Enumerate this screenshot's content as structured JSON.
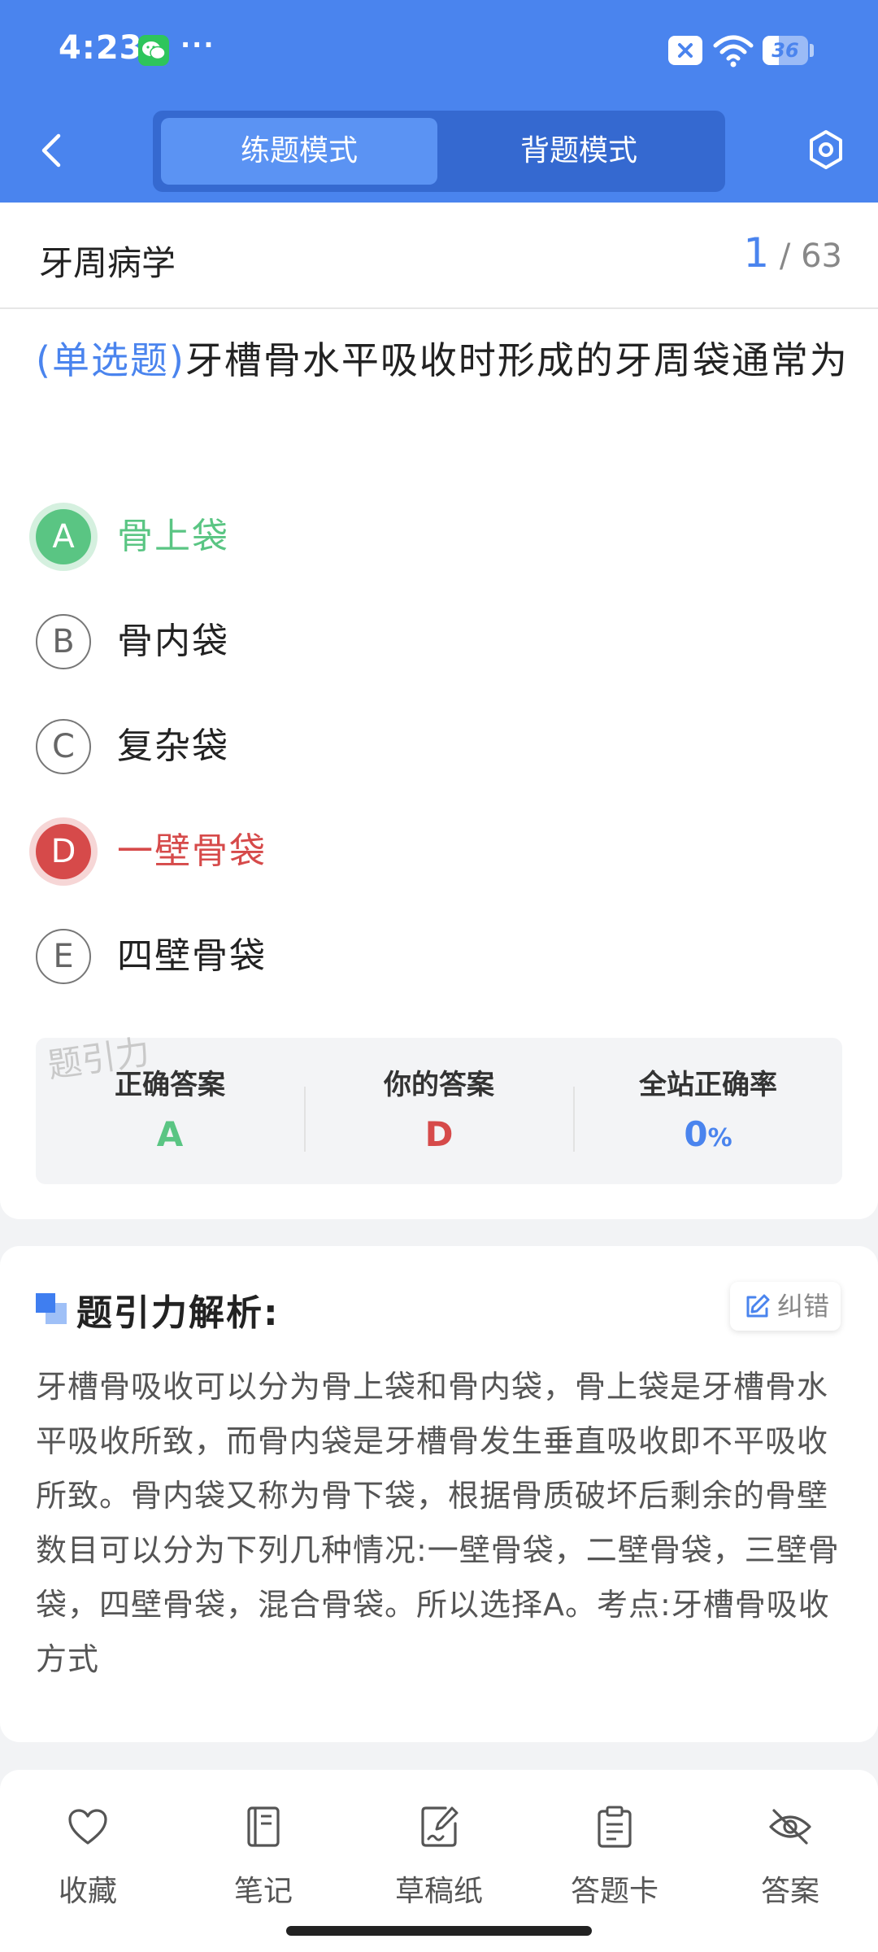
{
  "status_bar": {
    "time": "4:23",
    "battery": "36",
    "battery_level": 0.36
  },
  "header": {
    "tabs": [
      {
        "label": "练题模式",
        "active": true
      },
      {
        "label": "背题模式",
        "active": false
      }
    ]
  },
  "question_header": {
    "subject": "牙周病学",
    "current": "1",
    "total": "/ 63"
  },
  "question": {
    "type_tag": "(单选题)",
    "text": "牙槽骨水平吸收时形成的牙周袋通常为"
  },
  "options": [
    {
      "letter": "A",
      "text": "骨上袋",
      "state": "correct"
    },
    {
      "letter": "B",
      "text": "骨内袋",
      "state": "normal"
    },
    {
      "letter": "C",
      "text": "复杂袋",
      "state": "normal"
    },
    {
      "letter": "D",
      "text": "一壁骨袋",
      "state": "wrong"
    },
    {
      "letter": "E",
      "text": "四壁骨袋",
      "state": "normal"
    }
  ],
  "watermark": "题引力",
  "summary": {
    "correct_label": "正确答案",
    "correct_value": "A",
    "yours_label": "你的答案",
    "yours_value": "D",
    "rate_label": "全站正确率",
    "rate_value": "0",
    "rate_unit": "%"
  },
  "analysis": {
    "title": "题引力解析:",
    "report_label": "纠错",
    "body": "牙槽骨吸收可以分为骨上袋和骨内袋，骨上袋是牙槽骨水平吸收所致，而骨内袋是牙槽骨发生垂直吸收即不平吸收所致。骨内袋又称为骨下袋，根据骨质破坏后剩余的骨壁数目可以分为下列几种情况:一壁骨袋，二壁骨袋，三壁骨袋，四壁骨袋，混合骨袋。所以选择A。考点:牙槽骨吸收方式"
  },
  "toolbar": {
    "items": [
      {
        "label": "收藏",
        "icon": "heart-icon"
      },
      {
        "label": "笔记",
        "icon": "notebook-icon"
      },
      {
        "label": "草稿纸",
        "icon": "draft-icon"
      },
      {
        "label": "答题卡",
        "icon": "clipboard-icon"
      },
      {
        "label": "答案",
        "icon": "eye-off-icon"
      }
    ]
  },
  "colors": {
    "brand": "#4a84ee",
    "correct": "#5ac583",
    "wrong": "#d64a4a"
  }
}
